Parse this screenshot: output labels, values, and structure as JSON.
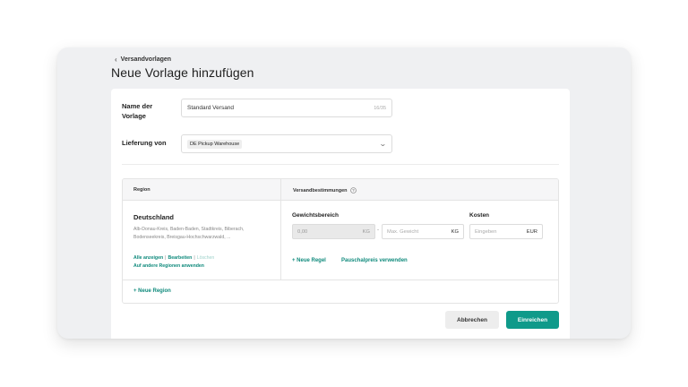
{
  "header": {
    "breadcrumb": "Versandvorlagen",
    "title": "Neue Vorlage hinzufügen"
  },
  "form": {
    "name_label": "Name der Vorlage",
    "name_value": "Standard Versand",
    "name_counter": "16/35",
    "delivery_label": "Lieferung von",
    "delivery_value": "DE Pickup Warehouse"
  },
  "table": {
    "col_region": "Region",
    "col_rules": "Versandbestimmungen",
    "region_name": "Deutschland",
    "region_list": "Alb-Donau-Kreis, Baden-Baden, Stadtkreis, Biberach, Bodenseekreis, Breisgau-Hochschwarzwald, ...",
    "link_show_all": "Alle anzeigen",
    "link_edit": "Bearbeiten",
    "link_delete": "Löschen",
    "link_apply_other": "Auf andere Regionen anwenden",
    "weight_range_label": "Gewichtsbereich",
    "weight_min_placeholder": "0,00",
    "weight_max_placeholder": "Max. Gewicht",
    "weight_unit": "KG",
    "cost_label": "Kosten",
    "cost_placeholder": "Eingeben",
    "currency": "EUR",
    "add_rule": "+ Neue Regel",
    "flat_rate": "Pauschalpreis verwenden",
    "add_region": "+ Neue Region"
  },
  "actions": {
    "cancel": "Abbrechen",
    "submit": "Einreichen"
  },
  "colors": {
    "accent": "#0f9a8a",
    "link": "#0f8a7c"
  }
}
